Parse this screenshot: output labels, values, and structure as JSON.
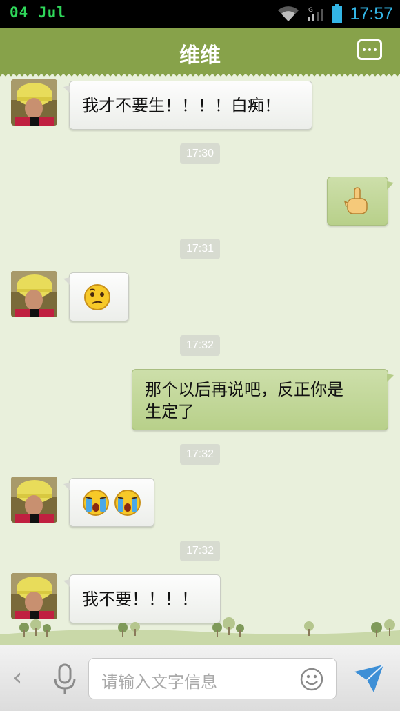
{
  "status_bar": {
    "date": "04 Jul",
    "time": "17:57"
  },
  "header": {
    "title": "维维",
    "menu_icon": "more-options-icon"
  },
  "messages": [
    {
      "side": "in",
      "type": "text",
      "text": "我才不要生！！！！白痴！"
    },
    {
      "type": "timestamp",
      "text": "17:30"
    },
    {
      "side": "out",
      "type": "emoji",
      "emoji": "pointing-finger-emoji"
    },
    {
      "type": "timestamp",
      "text": "17:31"
    },
    {
      "side": "in",
      "type": "emoji",
      "emoji": "confused-face-emoji"
    },
    {
      "type": "timestamp",
      "text": "17:32"
    },
    {
      "side": "out",
      "type": "text",
      "text_line1": "那个以后再说吧，反正你是",
      "text_line2": "生定了"
    },
    {
      "type": "timestamp",
      "text": "17:32"
    },
    {
      "side": "in",
      "type": "emoji",
      "emoji": "crying-face-emoji"
    },
    {
      "type": "timestamp",
      "text": "17:32"
    },
    {
      "side": "in",
      "type": "text",
      "text": "我不要！！！！"
    }
  ],
  "input_bar": {
    "placeholder": "请输入文字信息"
  },
  "colors": {
    "header": "#87a24a",
    "chat_bg": "#e9f0dc",
    "bubble_out": "#c3d99b",
    "bubble_in": "#f8f8f6",
    "accent_blue": "#3d8fd6"
  }
}
